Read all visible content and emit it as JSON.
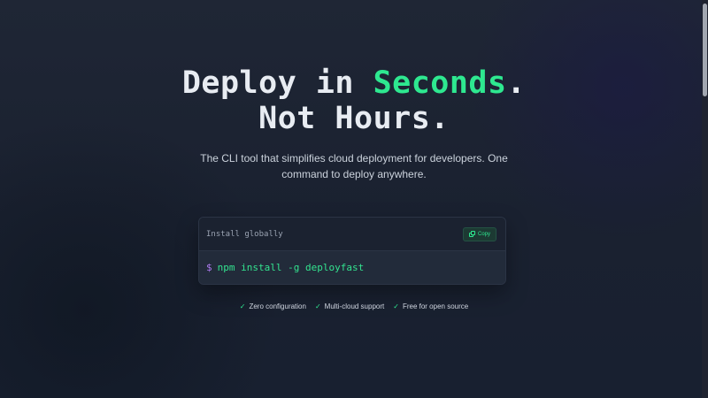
{
  "hero": {
    "headline_line1_part1": "Deploy in ",
    "headline_line1_accent": "Seconds",
    "headline_line1_part2": ".",
    "headline_line2": "Not Hours.",
    "subtitle": "The CLI tool that simplifies cloud deployment for developers. One command to deploy anywhere."
  },
  "install": {
    "label": "Install globally",
    "copy_label": "Copy",
    "prompt": "$",
    "command": "npm install -g deployfast"
  },
  "features": [
    {
      "label": "Zero configuration"
    },
    {
      "label": "Multi-cloud support"
    },
    {
      "label": "Free for open source"
    }
  ],
  "icons": {
    "check": "check-icon",
    "copy": "copy-icon"
  },
  "colors": {
    "accent": "#2ee890",
    "prompt": "#b07cf2",
    "background": "#1a2130"
  }
}
